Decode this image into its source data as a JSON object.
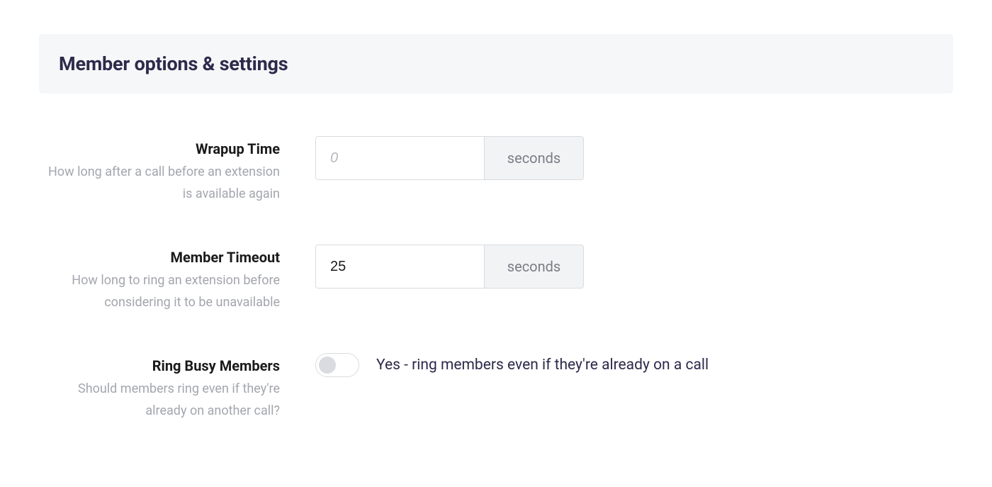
{
  "section": {
    "title": "Member options & settings"
  },
  "settings": {
    "wrapup": {
      "label": "Wrapup Time",
      "help": "How long after a call before an extension is available again",
      "value": "",
      "placeholder": "0",
      "unit": "seconds"
    },
    "member_timeout": {
      "label": "Member Timeout",
      "help": "How long to ring an extension before considering it to be unavailable",
      "value": "25",
      "placeholder": "",
      "unit": "seconds"
    },
    "ring_busy": {
      "label": "Ring Busy Members",
      "help": "Should members ring even if they're already on another call?",
      "toggle_state": "off",
      "description": "Yes - ring members even if they're already on a call"
    }
  }
}
